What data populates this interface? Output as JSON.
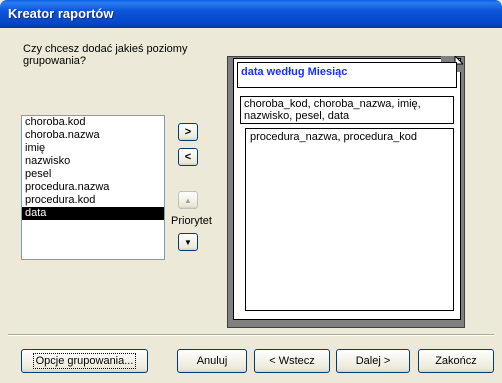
{
  "window": {
    "title": "Kreator raportów"
  },
  "prompt": "Czy chcesz dodać jakieś poziomy grupowania?",
  "fields": [
    "choroba.kod",
    "choroba.nazwa",
    "imię",
    "nazwisko",
    "pesel",
    "procedura.nazwa",
    "procedura.kod",
    "data"
  ],
  "selected_field": "data",
  "buttons": {
    "add": ">",
    "remove": "<",
    "priority_up": "▲",
    "priority_down": "▼",
    "priority_label": "Priorytet"
  },
  "preview": {
    "title": "data według Miesiąc",
    "level1": "choroba_kod, choroba_nazwa, imię, nazwisko, pesel, data",
    "level2": "procedura_nazwa, procedura_kod"
  },
  "footer": {
    "grouping_options": "Opcje grupowania...",
    "cancel": "Anuluj",
    "back": "< Wstecz",
    "next": "Dalej >",
    "finish": "Zakończ"
  },
  "colors": {
    "title_bar": "#0a55d8",
    "preview_title_text": "#1830ff",
    "selection": "#000000"
  }
}
